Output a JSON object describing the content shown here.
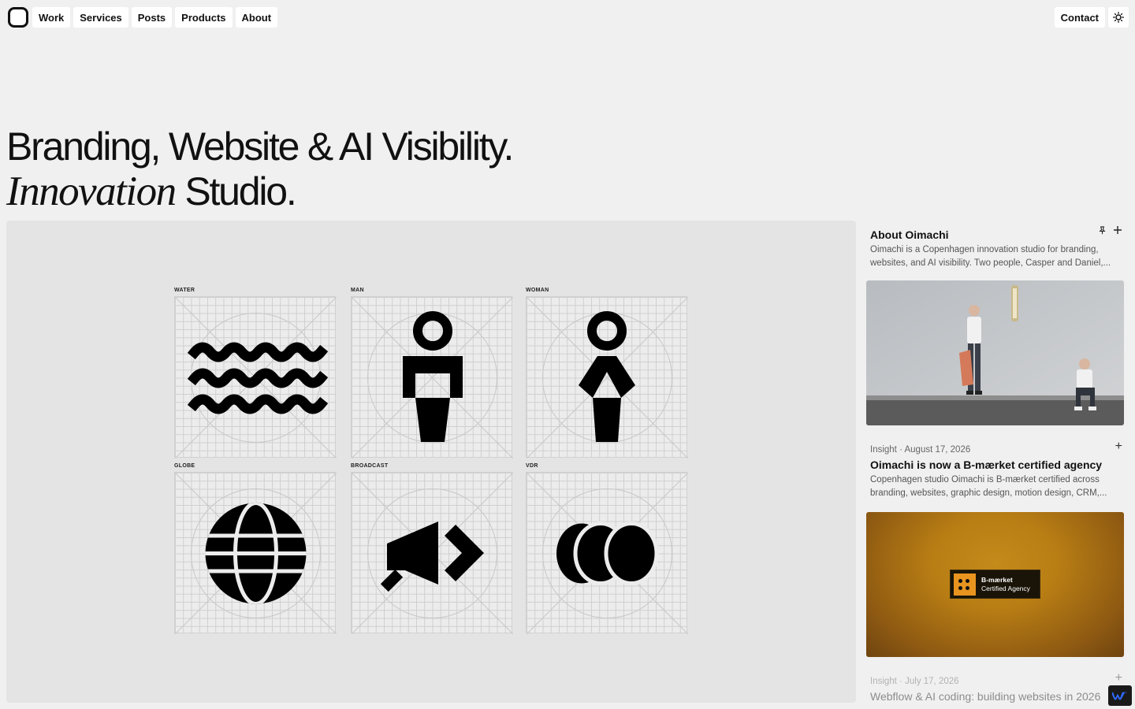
{
  "nav": {
    "items": [
      {
        "label": "Work"
      },
      {
        "label": "Services"
      },
      {
        "label": "Posts"
      },
      {
        "label": "Products"
      },
      {
        "label": "About"
      }
    ],
    "contact_label": "Contact",
    "theme_icon": "sun-icon",
    "logo_icon": "rounded-square-logo"
  },
  "hero": {
    "line1": "Branding, Website & AI Visibility.",
    "line2_italic": "Innovation",
    "line2_rest": " Studio."
  },
  "icons": [
    {
      "label": "WATER",
      "glyph": "water-waves-icon"
    },
    {
      "label": "MAN",
      "glyph": "man-figure-icon"
    },
    {
      "label": "WOMAN",
      "glyph": "woman-figure-icon"
    },
    {
      "label": "GLOBE",
      "glyph": "globe-icon"
    },
    {
      "label": "BROADCAST",
      "glyph": "broadcast-megaphone-icon"
    },
    {
      "label": "VDR",
      "glyph": "vdr-cylinders-icon"
    }
  ],
  "sidebar": {
    "about": {
      "title": "About Oimachi",
      "description": "Oimachi is a Copenhagen innovation studio for branding, websites, and AI visibility. Two people, Casper and Daniel,..."
    },
    "posts": [
      {
        "category": "Insight",
        "date": "August 17, 2026",
        "title": "Oimachi is now a B-mærket certified agency",
        "excerpt": "Copenhagen studio Oimachi is B-mærket certified across branding, websites, graphic design, motion design, CRM,..."
      },
      {
        "category": "Insight",
        "date": "July 17, 2026",
        "title": "Webflow & AI coding: building websites in 2026"
      }
    ],
    "badge": {
      "line1": "B-mærket",
      "line2": "Certified Agency"
    }
  },
  "colors": {
    "background": "#f0f0f0",
    "panel": "#e4e4e4",
    "badge_orange": "#e8941f"
  }
}
